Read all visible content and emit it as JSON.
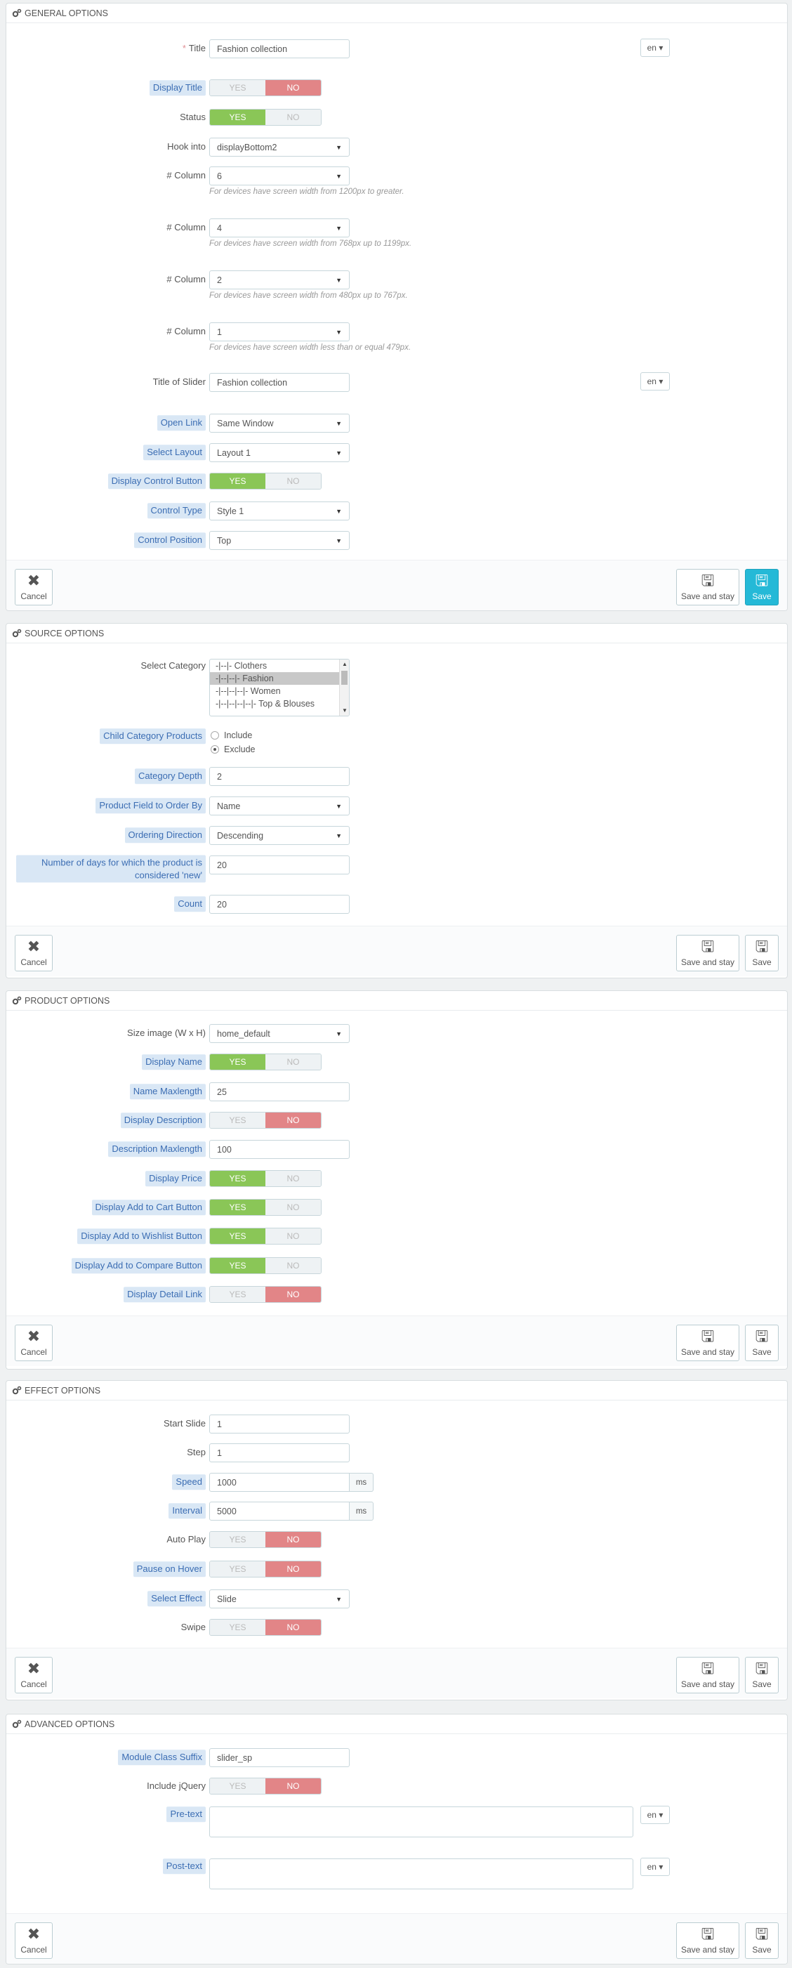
{
  "general": {
    "heading": "GENERAL OPTIONS",
    "title_label": "Title",
    "title_value": "Fashion collection",
    "lang": "en",
    "display_title_label": "Display Title",
    "status_label": "Status",
    "hook_label": "Hook into",
    "hook_value": "displayBottom2",
    "column_label": "# Column",
    "col1_value": "6",
    "col1_help": "For devices have screen width from 1200px to greater.",
    "col2_value": "4",
    "col2_help": "For devices have screen width from 768px up to 1199px.",
    "col3_value": "2",
    "col3_help": "For devices have screen width from 480px up to 767px.",
    "col4_value": "1",
    "col4_help": "For devices have screen width less than or equal 479px.",
    "slider_title_label": "Title of Slider",
    "slider_title_value": "Fashion collection",
    "open_link_label": "Open Link",
    "open_link_value": "Same Window",
    "layout_label": "Select Layout",
    "layout_value": "Layout 1",
    "control_button_label": "Display Control Button",
    "control_type_label": "Control Type",
    "control_type_value": "Style 1",
    "control_position_label": "Control Position",
    "control_position_value": "Top"
  },
  "source": {
    "heading": "SOURCE OPTIONS",
    "category_label": "Select Category",
    "categories": [
      "-|--|- Clothers",
      "-|--|--|- Fashion",
      "-|--|--|--|- Women",
      "-|--|--|--|--|- Top & Blouses"
    ],
    "child_label": "Child Category Products",
    "include": "Include",
    "exclude": "Exclude",
    "depth_label": "Category Depth",
    "depth_value": "2",
    "order_by_label": "Product Field to Order By",
    "order_by_value": "Name",
    "direction_label": "Ordering Direction",
    "direction_value": "Descending",
    "days_label": "Number of days for which the product is considered 'new'",
    "days_value": "20",
    "count_label": "Count",
    "count_value": "20"
  },
  "product": {
    "heading": "PRODUCT OPTIONS",
    "size_label": "Size image (W x H)",
    "size_value": "home_default",
    "display_name_label": "Display Name",
    "name_max_label": "Name Maxlength",
    "name_max_value": "25",
    "display_desc_label": "Display Description",
    "desc_max_label": "Description Maxlength",
    "desc_max_value": "100",
    "display_price_label": "Display Price",
    "cart_label": "Display Add to Cart Button",
    "wishlist_label": "Display Add to Wishlist Button",
    "compare_label": "Display Add to Compare Button",
    "detail_label": "Display Detail Link"
  },
  "effect": {
    "heading": "EFFECT OPTIONS",
    "start_label": "Start Slide",
    "start_value": "1",
    "step_label": "Step",
    "step_value": "1",
    "speed_label": "Speed",
    "speed_value": "1000",
    "interval_label": "Interval",
    "interval_value": "5000",
    "unit": "ms",
    "autoplay_label": "Auto Play",
    "pause_label": "Pause on Hover",
    "effect_label": "Select Effect",
    "effect_value": "Slide",
    "swipe_label": "Swipe"
  },
  "advanced": {
    "heading": "ADVANCED OPTIONS",
    "suffix_label": "Module Class Suffix",
    "suffix_value": "slider_sp",
    "jquery_label": "Include jQuery",
    "pretext_label": "Pre-text",
    "posttext_label": "Post-text",
    "lang": "en"
  },
  "toggle": {
    "yes": "YES",
    "no": "NO"
  },
  "buttons": {
    "cancel": "Cancel",
    "save_stay": "Save and stay",
    "save": "Save"
  },
  "colors": {
    "yes_active": "#8ac657",
    "no_active": "#e28587",
    "primary": "#25b9d7",
    "hint_bg": "#d9e7f5"
  }
}
